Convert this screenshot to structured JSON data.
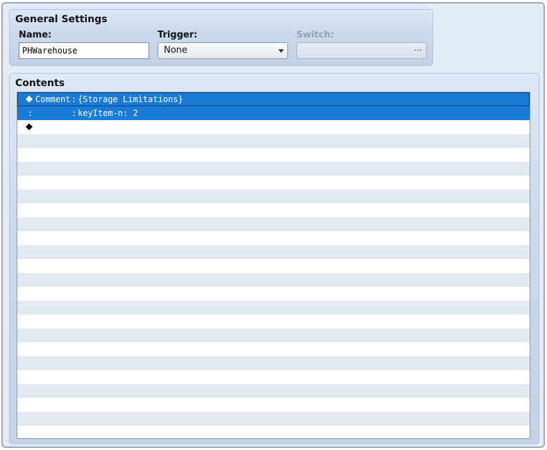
{
  "general": {
    "title": "General Settings",
    "name_label": "Name:",
    "name_value": "PHWarehouse",
    "trigger_label": "Trigger:",
    "trigger_value": "None",
    "switch_label": "Switch:",
    "switch_button": "⋯"
  },
  "contents": {
    "title": "Contents",
    "rows": [
      {
        "marker": "◆",
        "command": "Comment",
        "sep": ":",
        "param": "{Storage Limitations}"
      },
      {
        "marker": ":",
        "command": "",
        "sep": ":",
        "param": "keyItem-n: 2"
      },
      {
        "marker": "◆",
        "command": "",
        "sep": "",
        "param": ""
      }
    ]
  },
  "colors": {
    "selection": "#1a7bd7",
    "row_alt": "#e3e9f1",
    "panel": "#cbd9ec"
  }
}
